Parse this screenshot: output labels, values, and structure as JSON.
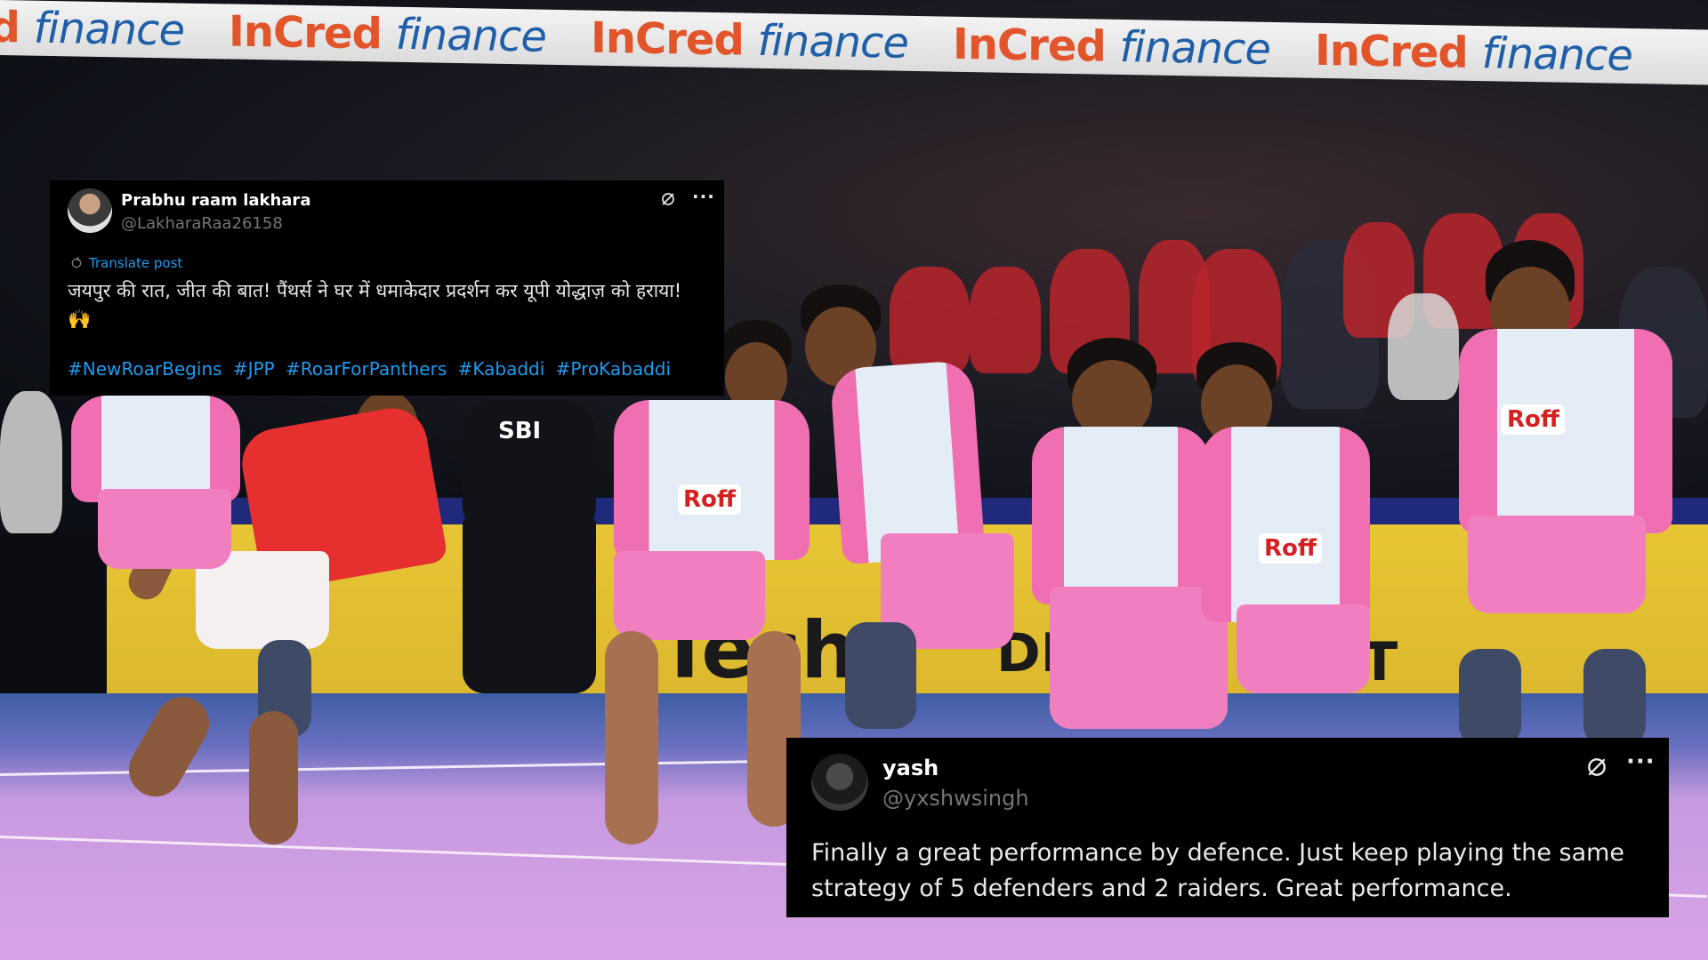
{
  "banner": {
    "brand_left": "InCred",
    "brand_right": "finance"
  },
  "background_texts": {
    "sponsor_fragment": "Tech",
    "board_fragment_1": "DIA",
    "board_fragment_2": "NT",
    "ref_logo": "SBI",
    "jersey_sponsor": "Roff"
  },
  "tweet_1": {
    "display_name": "Prabhu raam lakhara",
    "handle": "@LakharaRaa26158",
    "translate_label": "Translate post",
    "text": "जयपुर की रात, जीत की बात! पैंथर्स ने घर में धमाकेदार प्रदर्शन कर यूपी योद्धाज़ को हराया! 🙌",
    "hashtags": [
      "#NewRoarBegins",
      "#JPP",
      "#RoarForPanthers",
      "#Kabaddi",
      "#ProKabaddi"
    ],
    "more_label": "···"
  },
  "tweet_2": {
    "display_name": "yash",
    "handle": "@yxshwsingh",
    "text": "Finally a great performance by defence. Just keep playing the same strategy of 5 defenders and 2 raiders. Great performance.",
    "more_label": "···"
  },
  "colors": {
    "card_bg": "#000000",
    "link_blue": "#1d9bf0",
    "handle_gray": "#71767b",
    "panthers_pink": "#f06fb2",
    "yoddhas_red": "#e5302f"
  },
  "icons": [
    "grok-icon",
    "more-icon",
    "translate-icon",
    "avatar"
  ]
}
